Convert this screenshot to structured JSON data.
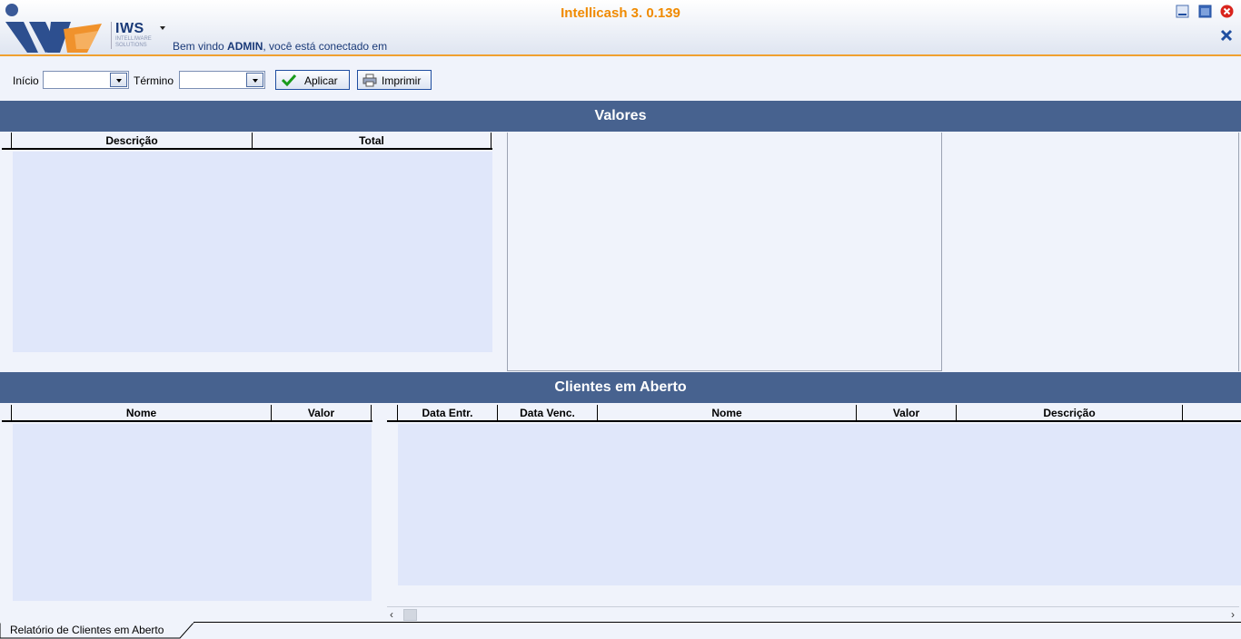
{
  "app": {
    "title": "Intellicash 3. 0.139",
    "logo_text": "IWS",
    "logo_sub_1": "INTELLIWARE",
    "logo_sub_2": "SOLUTIONS",
    "welcome_prefix": "Bem vindo ",
    "welcome_user": "ADMIN",
    "welcome_suffix": ", você está conectado em"
  },
  "toolbar": {
    "inicio_label": "Início",
    "termino_label": "Término",
    "inicio_value": "",
    "termino_value": "",
    "apply_label": "Aplicar",
    "print_label": "Imprimir"
  },
  "valores": {
    "title": "Valores",
    "columns": [
      "Descrição",
      "Total"
    ]
  },
  "clientes": {
    "title": "Clientes em Aberto",
    "left_columns": [
      "Nome",
      "Valor"
    ],
    "right_columns": [
      "Data Entr.",
      "Data Venc.",
      "Nome",
      "Valor",
      "Descrição"
    ]
  },
  "tabs": {
    "active": "Relatório de Clientes em Aberto"
  },
  "colors": {
    "accent_orange": "#f08a00",
    "section_header": "#47628f",
    "grid_body": "#e0e7fa",
    "background": "#f0f3fb",
    "logo_blue": "#1a3a78"
  }
}
